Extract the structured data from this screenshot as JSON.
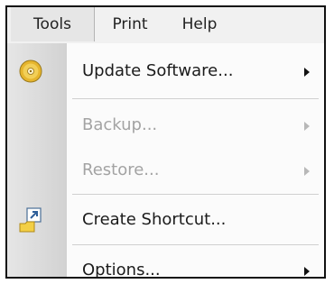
{
  "menubar": {
    "items": [
      {
        "label": "Tools"
      },
      {
        "label": "Print"
      },
      {
        "label": "Help"
      }
    ]
  },
  "menu": {
    "items": [
      {
        "label": "Update Software...",
        "icon": "cd-disc-icon",
        "enabled": true,
        "submenu": true
      },
      {
        "label": "Backup...",
        "enabled": false,
        "submenu": true
      },
      {
        "label": "Restore...",
        "enabled": false,
        "submenu": true
      },
      {
        "label": "Create Shortcut...",
        "icon": "shortcut-icon",
        "enabled": true,
        "submenu": false
      },
      {
        "label": "Options...",
        "enabled": true,
        "submenu": true
      }
    ]
  },
  "colors": {
    "disabled_text": "#a3a3a3",
    "gutter": "#d2d2d2",
    "menubar": "#f1f1f1"
  }
}
